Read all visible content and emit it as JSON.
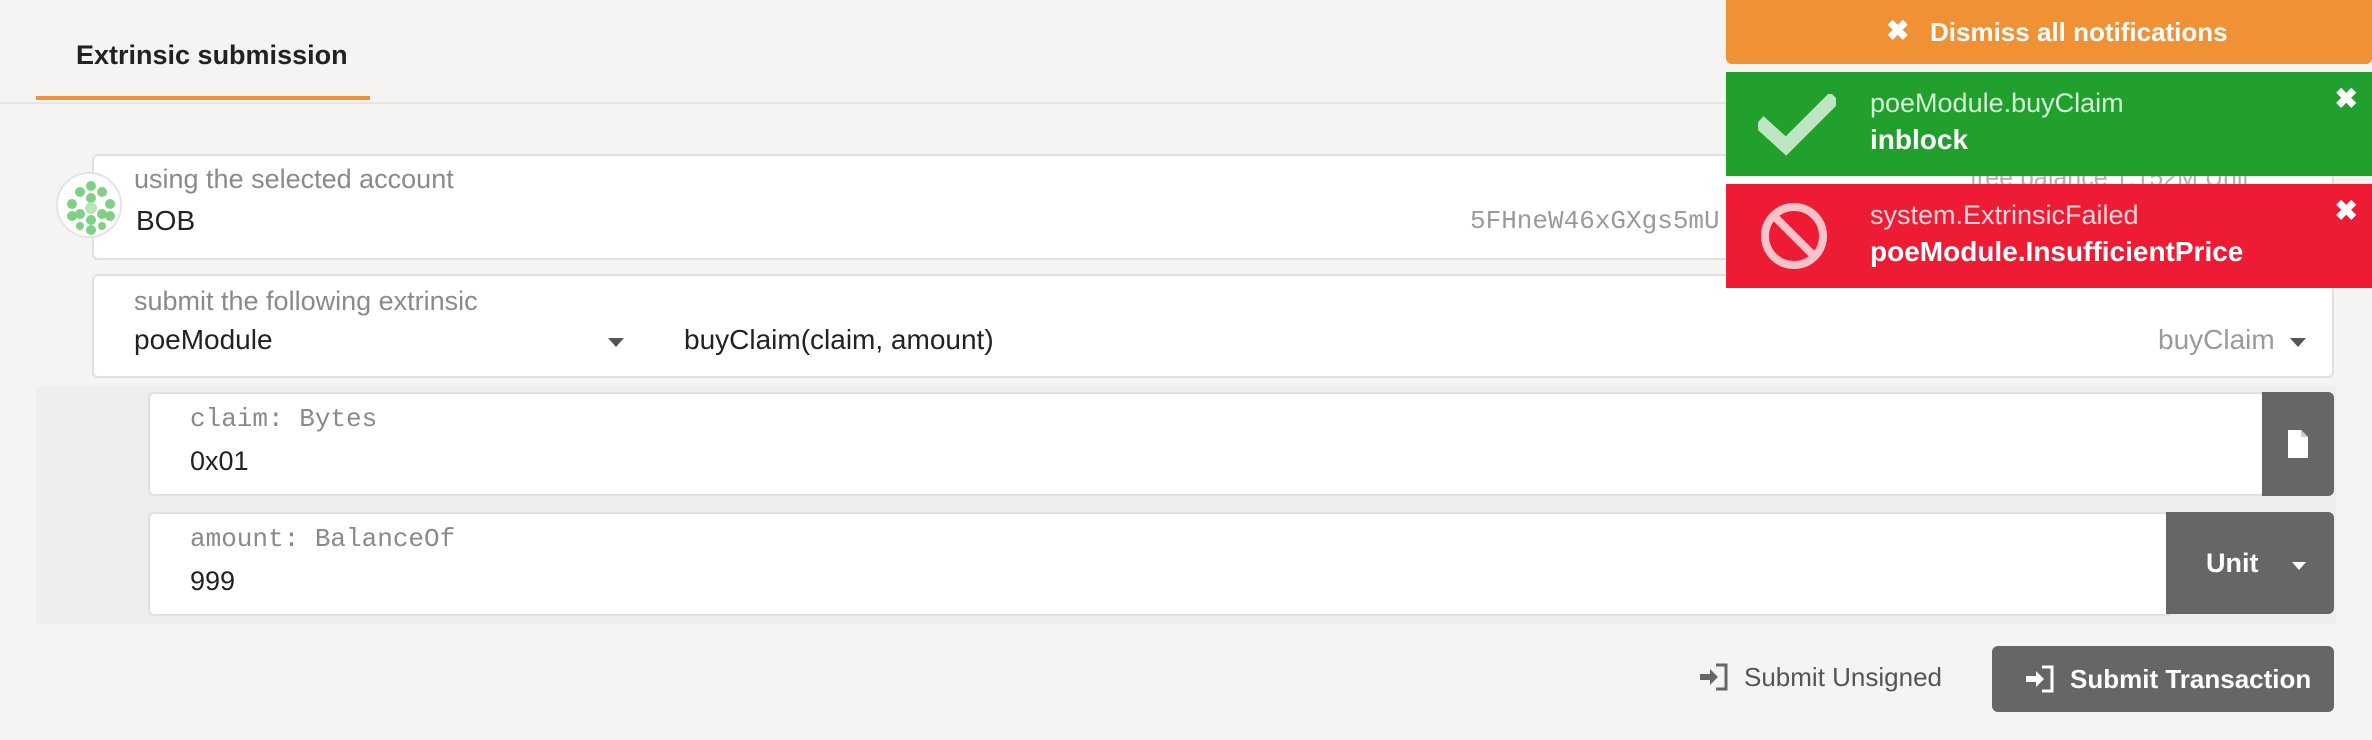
{
  "tab": {
    "label": "Extrinsic submission"
  },
  "account": {
    "label": "using the selected account",
    "name": "BOB",
    "address": "5FHneW46xGXgs5mU",
    "balance_label": "free balance",
    "balance_value": "1.152M Unit"
  },
  "extrinsic": {
    "label": "submit the following extrinsic",
    "module": "poeModule",
    "call_signature": "buyClaim(claim, amount)",
    "call": "buyClaim"
  },
  "params": [
    {
      "label": "claim: Bytes",
      "value": "0x01"
    },
    {
      "label": "amount: BalanceOf",
      "value": "999",
      "unit": "Unit"
    }
  ],
  "actions": {
    "unsigned": "Submit Unsigned",
    "submit": "Submit Transaction"
  },
  "notifications": {
    "dismiss_all": "Dismiss all notifications",
    "items": [
      {
        "title": "poeModule.buyClaim",
        "status": "inblock",
        "color": "#21a02d",
        "icon": "check-icon"
      },
      {
        "title": "system.ExtrinsicFailed",
        "status": "poeModule.InsufficientPrice",
        "color": "#ee1b34",
        "icon": "blocked-icon"
      }
    ]
  },
  "colors": {
    "accent": "#f19135",
    "dark_button": "#666666"
  }
}
